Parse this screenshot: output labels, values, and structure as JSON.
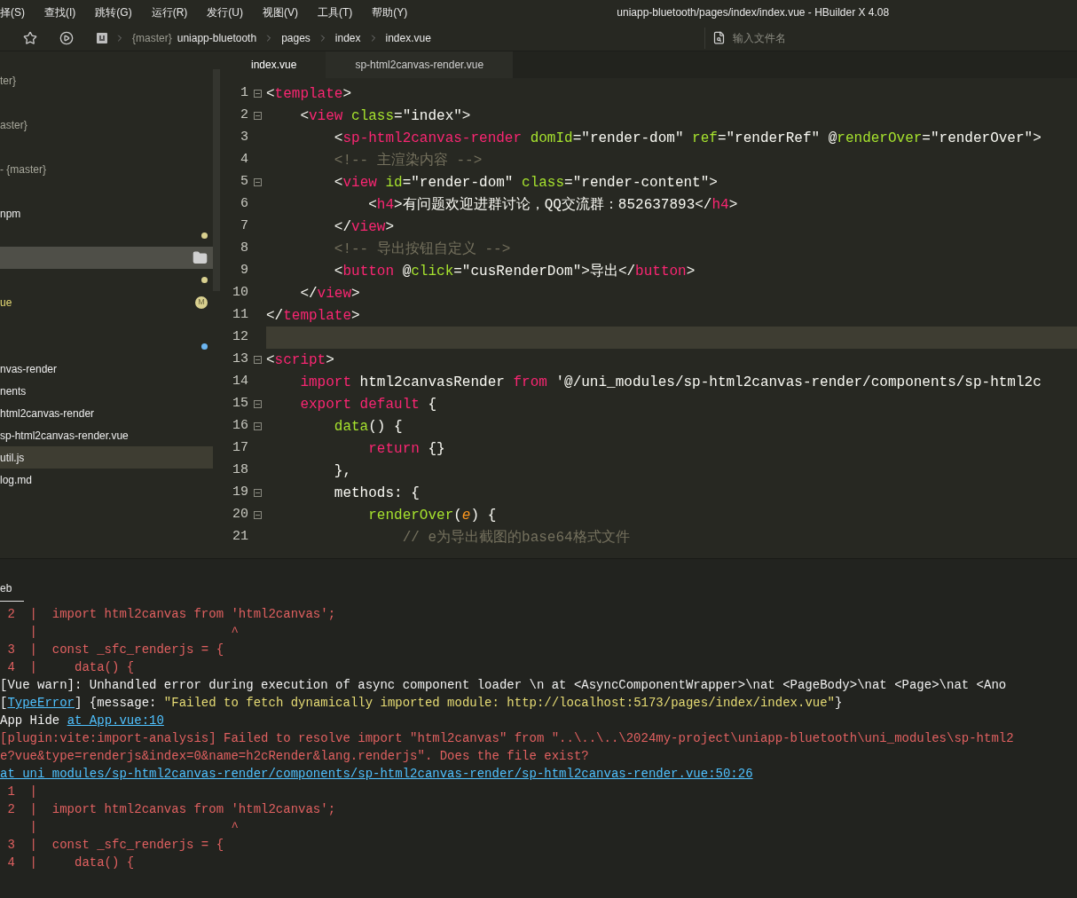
{
  "menu": [
    "择(S)",
    "查找(I)",
    "跳转(G)",
    "运行(R)",
    "发行(U)",
    "视图(V)",
    "工具(T)",
    "帮助(Y)"
  ],
  "window": {
    "title": "uniapp-bluetooth/pages/index/index.vue - HBuilder X 4.08"
  },
  "breadcrumb": {
    "branch": "{master}",
    "items": [
      "uniapp-bluetooth",
      "pages",
      "index",
      "index.vue"
    ]
  },
  "search": {
    "placeholder": "输入文件名"
  },
  "sidebar": {
    "items": [
      {
        "label": "ter}",
        "branch": true,
        "selected": false,
        "hovered": false
      },
      {
        "selected": false,
        "hovered": false
      },
      {
        "label": "aster}",
        "branch": true,
        "selected": false,
        "hovered": false
      },
      {
        "selected": false,
        "hovered": false
      },
      {
        "label": "- {master}",
        "branch": true,
        "selected": false,
        "hovered": false
      },
      {
        "selected": false,
        "hovered": false
      },
      {
        "label": "npm",
        "branch": false,
        "selected": false,
        "hovered": false
      },
      {
        "selected": false,
        "hovered": false,
        "marker": {
          "kind": "dot",
          "color": "#d9d08f"
        }
      },
      {
        "selected": true,
        "hovered": false,
        "marker": {
          "kind": "folder"
        }
      },
      {
        "selected": false,
        "hovered": false,
        "marker": {
          "kind": "dot",
          "color": "#d9d08f"
        }
      },
      {
        "label": "ue",
        "branch": false,
        "modified": true,
        "selected": false,
        "hovered": false,
        "marker": {
          "kind": "badge",
          "text": "M"
        }
      },
      {
        "selected": false,
        "hovered": false
      },
      {
        "selected": false,
        "hovered": false,
        "marker": {
          "kind": "dot",
          "color": "#6cb6f2"
        }
      },
      {
        "label": "nvas-render",
        "branch": false,
        "selected": false,
        "hovered": false
      },
      {
        "label": "nents",
        "branch": false,
        "selected": false,
        "hovered": false
      },
      {
        "label": "html2canvas-render",
        "branch": false,
        "selected": false,
        "hovered": false
      },
      {
        "label": "sp-html2canvas-render.vue",
        "branch": false,
        "selected": false,
        "hovered": false
      },
      {
        "label": "util.js",
        "branch": false,
        "selected": false,
        "hovered": true
      },
      {
        "label": "log.md",
        "branch": false,
        "selected": false,
        "hovered": false
      }
    ]
  },
  "tabs": [
    {
      "label": "index.vue",
      "selected": true
    },
    {
      "label": "sp-html2canvas-render.vue",
      "selected": false
    }
  ],
  "editor": {
    "lines": [
      {
        "number": "1",
        "foldable": true,
        "current": false,
        "tokens": [
          {
            "kind": "plain",
            "text": "<"
          },
          {
            "kind": "tag",
            "text": "template"
          },
          {
            "kind": "plain",
            "text": ">"
          }
        ]
      },
      {
        "number": "2",
        "foldable": true,
        "current": false,
        "tokens": [
          {
            "kind": "plain",
            "text": "    <"
          },
          {
            "kind": "tag",
            "text": "view"
          },
          {
            "kind": "attr",
            "text": " class"
          },
          {
            "kind": "plain",
            "text": "=\"index\">"
          }
        ]
      },
      {
        "number": "3",
        "foldable": false,
        "current": false,
        "tokens": [
          {
            "kind": "plain",
            "text": "        <"
          },
          {
            "kind": "tag",
            "text": "sp-html2canvas-render"
          },
          {
            "kind": "attr",
            "text": " domId"
          },
          {
            "kind": "plain",
            "text": "=\"render-dom\" "
          },
          {
            "kind": "attr",
            "text": "ref"
          },
          {
            "kind": "plain",
            "text": "=\"renderRef\" @"
          },
          {
            "kind": "attr",
            "text": "renderOver"
          },
          {
            "kind": "plain",
            "text": "=\"renderOver\">"
          }
        ]
      },
      {
        "number": "4",
        "foldable": false,
        "current": false,
        "tokens": [
          {
            "kind": "comment",
            "text": "        <!-- 主渲染内容 -->"
          }
        ]
      },
      {
        "number": "5",
        "foldable": true,
        "current": false,
        "tokens": [
          {
            "kind": "plain",
            "text": "        <"
          },
          {
            "kind": "tag",
            "text": "view"
          },
          {
            "kind": "attr",
            "text": " id"
          },
          {
            "kind": "plain",
            "text": "=\"render-dom\" "
          },
          {
            "kind": "attr",
            "text": "class"
          },
          {
            "kind": "plain",
            "text": "=\"render-content\">"
          }
        ]
      },
      {
        "number": "6",
        "foldable": false,
        "current": false,
        "tokens": [
          {
            "kind": "plain",
            "text": "            <"
          },
          {
            "kind": "tag",
            "text": "h4"
          },
          {
            "kind": "plain",
            "text": ">有问题欢迎进群讨论，QQ交流群：852637893</"
          },
          {
            "kind": "tag",
            "text": "h4"
          },
          {
            "kind": "plain",
            "text": ">"
          }
        ]
      },
      {
        "number": "7",
        "foldable": false,
        "current": false,
        "tokens": [
          {
            "kind": "plain",
            "text": "        </"
          },
          {
            "kind": "tag",
            "text": "view"
          },
          {
            "kind": "plain",
            "text": ">"
          }
        ]
      },
      {
        "number": "8",
        "foldable": false,
        "current": false,
        "tokens": [
          {
            "kind": "comment",
            "text": "        <!-- 导出按钮自定义 -->"
          }
        ]
      },
      {
        "number": "9",
        "foldable": false,
        "current": false,
        "tokens": [
          {
            "kind": "plain",
            "text": "        <"
          },
          {
            "kind": "tag",
            "text": "button"
          },
          {
            "kind": "plain",
            "text": " @"
          },
          {
            "kind": "attr",
            "text": "click"
          },
          {
            "kind": "plain",
            "text": "=\"cusRenderDom\">导出</"
          },
          {
            "kind": "tag",
            "text": "button"
          },
          {
            "kind": "plain",
            "text": ">"
          }
        ]
      },
      {
        "number": "10",
        "foldable": false,
        "current": false,
        "tokens": [
          {
            "kind": "plain",
            "text": "    </"
          },
          {
            "kind": "tag",
            "text": "view"
          },
          {
            "kind": "plain",
            "text": ">"
          }
        ]
      },
      {
        "number": "11",
        "foldable": false,
        "current": false,
        "tokens": [
          {
            "kind": "plain",
            "text": "</"
          },
          {
            "kind": "tag",
            "text": "template"
          },
          {
            "kind": "plain",
            "text": ">"
          }
        ]
      },
      {
        "number": "12",
        "foldable": false,
        "current": true
      },
      {
        "number": "13",
        "foldable": true,
        "current": false,
        "tokens": [
          {
            "kind": "plain",
            "text": "<"
          },
          {
            "kind": "tag",
            "text": "script"
          },
          {
            "kind": "plain",
            "text": ">"
          }
        ]
      },
      {
        "number": "14",
        "foldable": false,
        "current": false,
        "tokens": [
          {
            "kind": "keyword",
            "text": "    import"
          },
          {
            "kind": "plain",
            "text": " html2canvasRender "
          },
          {
            "kind": "keyword",
            "text": "from"
          },
          {
            "kind": "plain",
            "text": " '@/uni_modules/sp-html2canvas-render/components/sp-html2c"
          }
        ]
      },
      {
        "number": "15",
        "foldable": true,
        "current": false,
        "tokens": [
          {
            "kind": "keyword",
            "text": "    export default"
          },
          {
            "kind": "plain",
            "text": " {"
          }
        ]
      },
      {
        "number": "16",
        "foldable": true,
        "current": false,
        "tokens": [
          {
            "kind": "function",
            "text": "        data"
          },
          {
            "kind": "plain",
            "text": "() {"
          }
        ]
      },
      {
        "number": "17",
        "foldable": false,
        "current": false,
        "tokens": [
          {
            "kind": "keyword",
            "text": "            return"
          },
          {
            "kind": "plain",
            "text": " {}"
          }
        ]
      },
      {
        "number": "18",
        "foldable": false,
        "current": false,
        "tokens": [
          {
            "kind": "plain",
            "text": "        },"
          }
        ]
      },
      {
        "number": "19",
        "foldable": true,
        "current": false,
        "tokens": [
          {
            "kind": "plain",
            "text": "        methods: {"
          }
        ]
      },
      {
        "number": "20",
        "foldable": true,
        "current": false,
        "tokens": [
          {
            "kind": "function",
            "text": "            renderOver"
          },
          {
            "kind": "plain",
            "text": "("
          },
          {
            "kind": "param",
            "text": "e"
          },
          {
            "kind": "plain",
            "text": ") {"
          }
        ]
      },
      {
        "number": "21",
        "foldable": false,
        "current": false,
        "tokens": [
          {
            "kind": "comment",
            "text": "                // e为导出截图的base64格式文件"
          }
        ]
      }
    ]
  },
  "console": {
    "tab": "eb",
    "lines": [
      [
        {
          "kind": "error",
          "text": " 2  |  import html2canvas from 'html2canvas';"
        }
      ],
      [
        {
          "kind": "error",
          "text": "    |                          ^"
        }
      ],
      [
        {
          "kind": "error",
          "text": " 3  |  const _sfc_renderjs = {"
        }
      ],
      [
        {
          "kind": "error",
          "text": " 4  |     data() {"
        }
      ],
      [
        {
          "kind": "plain",
          "text": "[Vue warn]: Unhandled error during execution of async component loader \\n at <AsyncComponentWrapper>\\nat <PageBody>\\nat <Page>\\nat <Ano"
        }
      ],
      [
        {
          "kind": "plain",
          "text": "["
        },
        {
          "kind": "link",
          "text": "TypeError"
        },
        {
          "kind": "plain",
          "text": "] {message: "
        },
        {
          "kind": "string",
          "text": "\"Failed to fetch dynamically imported module: http://localhost:5173/pages/index/index.vue\""
        },
        {
          "kind": "plain",
          "text": "}"
        }
      ],
      [
        {
          "kind": "plain",
          "text": "App Hide "
        },
        {
          "kind": "link",
          "text": "at App.vue:10"
        }
      ],
      [
        {
          "kind": "error",
          "text": "[plugin:vite:import-analysis] Failed to resolve import \"html2canvas\" from \"..\\..\\..\\2024my-project\\uniapp-bluetooth\\uni_modules\\sp-html2"
        }
      ],
      [
        {
          "kind": "error",
          "text": "e?vue&type=renderjs&index=0&name=h2cRender&lang.renderjs\". Does the file exist?"
        }
      ],
      [
        {
          "kind": "link",
          "text": "at uni_modules/sp-html2canvas-render/components/sp-html2canvas-render/sp-html2canvas-render.vue:50:26"
        }
      ],
      [
        {
          "kind": "error",
          "text": " 1  |"
        }
      ],
      [
        {
          "kind": "error",
          "text": " 2  |  import html2canvas from 'html2canvas';"
        }
      ],
      [
        {
          "kind": "error",
          "text": "    |                          ^"
        }
      ],
      [
        {
          "kind": "error",
          "text": " 3  |  const _sfc_renderjs = {"
        }
      ],
      [
        {
          "kind": "error",
          "text": " 4  |     data() {"
        }
      ]
    ]
  }
}
